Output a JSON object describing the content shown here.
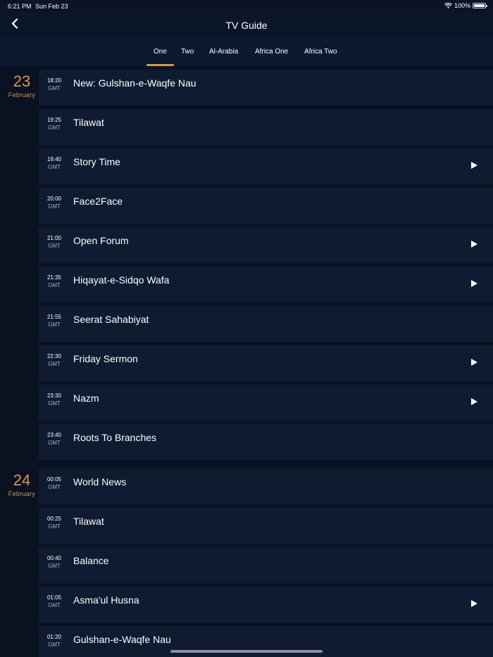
{
  "status_bar": {
    "time": "6:21 PM",
    "date": "Sun Feb 23",
    "battery": "100%"
  },
  "nav": {
    "title": "TV Guide"
  },
  "tabs": [
    {
      "label": "One",
      "selected": true
    },
    {
      "label": "Two",
      "selected": false
    },
    {
      "label": "Al-Arabia",
      "selected": false
    },
    {
      "label": "Africa One",
      "selected": false
    },
    {
      "label": "Africa Two",
      "selected": false
    }
  ],
  "colors": {
    "accent": "#d9964b",
    "background": "#0a1426",
    "row": "#0f1b31"
  },
  "schedule": {
    "days": [
      {
        "day": "23",
        "month": "February"
      },
      {
        "day": "24",
        "month": "February"
      }
    ],
    "programs": [
      {
        "time": "18:20",
        "tz": "GMT",
        "title": "New: Gulshan-e-Waqfe Nau",
        "playable": false
      },
      {
        "time": "19:25",
        "tz": "GMT",
        "title": "Tilawat",
        "playable": false
      },
      {
        "time": "19:40",
        "tz": "GMT",
        "title": "Story Time",
        "playable": true
      },
      {
        "time": "20:00",
        "tz": "GMT",
        "title": "Face2Face",
        "playable": false
      },
      {
        "time": "21:00",
        "tz": "GMT",
        "title": "Open Forum",
        "playable": true
      },
      {
        "time": "21:35",
        "tz": "GMT",
        "title": "Hiqayat-e-Sidqo Wafa",
        "playable": true
      },
      {
        "time": "21:55",
        "tz": "GMT",
        "title": "Seerat Sahabiyat",
        "playable": false
      },
      {
        "time": "22:30",
        "tz": "GMT",
        "title": "Friday Sermon",
        "playable": true
      },
      {
        "time": "23:30",
        "tz": "GMT",
        "title": "Nazm",
        "playable": true
      },
      {
        "time": "23:40",
        "tz": "GMT",
        "title": "Roots To Branches",
        "playable": false
      },
      {
        "time": "00:05",
        "tz": "GMT",
        "title": "World News",
        "playable": false
      },
      {
        "time": "00:25",
        "tz": "GMT",
        "title": "Tilawat",
        "playable": false
      },
      {
        "time": "00:40",
        "tz": "GMT",
        "title": "Balance",
        "playable": false
      },
      {
        "time": "01:05",
        "tz": "GMT",
        "title": "Asma'ul Husna",
        "playable": true
      },
      {
        "time": "01:20",
        "tz": "GMT",
        "title": "Gulshan-e-Waqfe Nau",
        "playable": false
      }
    ]
  }
}
